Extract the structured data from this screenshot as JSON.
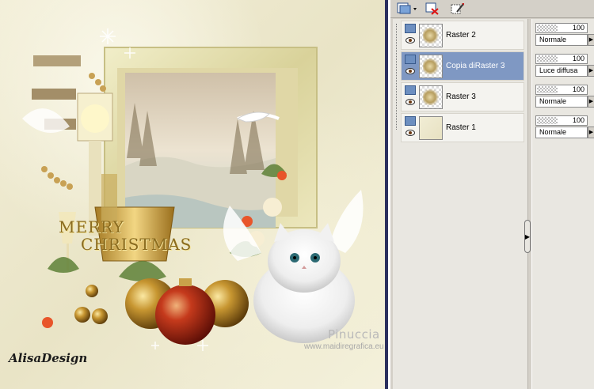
{
  "canvas": {
    "title_text": {
      "line1": "MERRY",
      "line2": "CHRISTMAS"
    },
    "watermark": {
      "name": "Pinuccia",
      "url": "www.maidiregrafica.eu"
    },
    "signature": "AlisaDesign"
  },
  "toolbar": {
    "icons": [
      "new-layer-icon",
      "delete-layer-icon",
      "layer-properties-icon"
    ]
  },
  "layers": [
    {
      "name": "Raster 2",
      "selected": false,
      "thumb": "art"
    },
    {
      "name": "Copia diRaster 3",
      "selected": true,
      "thumb": "art"
    },
    {
      "name": "Raster 3",
      "selected": false,
      "thumb": "art"
    },
    {
      "name": "Raster 1",
      "selected": false,
      "thumb": "flat"
    }
  ],
  "layer_props": [
    {
      "opacity": "100",
      "blend": "Normale"
    },
    {
      "opacity": "100",
      "blend": "Luce diffusa"
    },
    {
      "opacity": "100",
      "blend": "Normale"
    },
    {
      "opacity": "100",
      "blend": "Normale"
    }
  ],
  "colors": {
    "selected_row": "#7f98c3",
    "panel_bg": "#d4d0c8",
    "canvas_border": "#2b2f5e"
  }
}
